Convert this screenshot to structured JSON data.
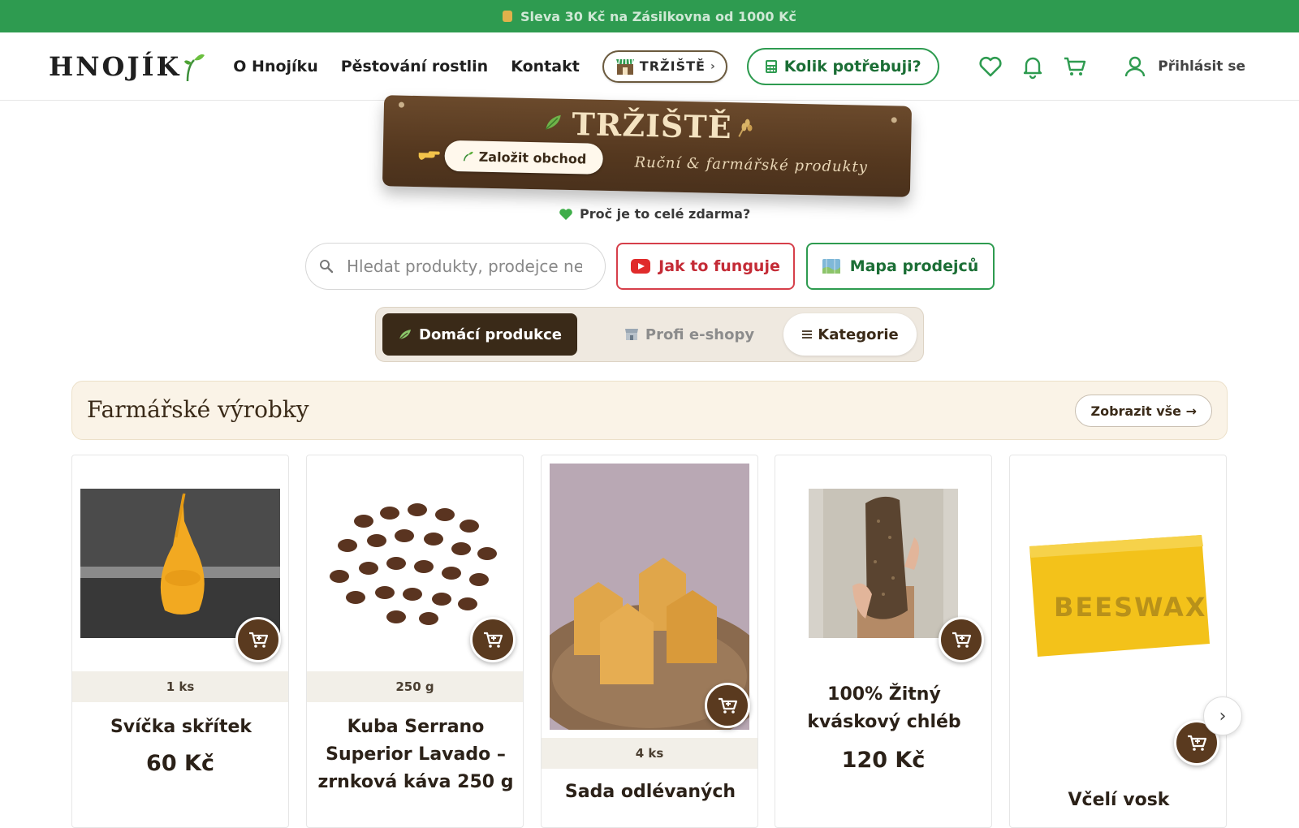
{
  "promo": {
    "text": "Sleva 30 Kč na Zásilkovna od 1000 Kč"
  },
  "header": {
    "logo": "HNOJÍK",
    "nav": [
      "O Hnojíku",
      "Pěstování rostlin",
      "Kontakt"
    ],
    "trziste_pill": "TRŽIŠTĚ",
    "kolik": "Kolik potřebuji?",
    "login": "Přihlásit se"
  },
  "board": {
    "title": "TRŽIŠTĚ",
    "subtitle": "Ruční & farmářské produkty",
    "create_shop": "Založit obchod"
  },
  "why_free": "Proč je to celé zdarma?",
  "search": {
    "placeholder": "Hledat produkty, prodejce ne"
  },
  "buttons": {
    "how_it_works": "Jak to funguje",
    "sellers_map": "Mapa prodejců"
  },
  "tabs": {
    "home_production": "Domácí produkce",
    "pro_eshops": "Profi e-shopy",
    "categories": "Kategorie"
  },
  "section": {
    "title": "Farmářské výrobky",
    "show_all": "Zobrazit vše →"
  },
  "products": [
    {
      "qty": "1 ks",
      "name": "Svíčka skřítek",
      "price": "60 Kč"
    },
    {
      "qty": "250 g",
      "name": "Kuba Serrano Superior Lavado – zrnková káva 250 g",
      "price": ""
    },
    {
      "qty": "4 ks",
      "name": "Sada odlévaných",
      "price": ""
    },
    {
      "qty": "",
      "name": "100% Žitný kváskový chléb",
      "price": "120 Kč"
    },
    {
      "qty": "",
      "name": "Včelí vosk",
      "price": ""
    }
  ],
  "colors": {
    "green": "#2e9b50",
    "brown": "#5a3a1f",
    "red": "#d63f4a",
    "cream": "#faf3e7"
  }
}
